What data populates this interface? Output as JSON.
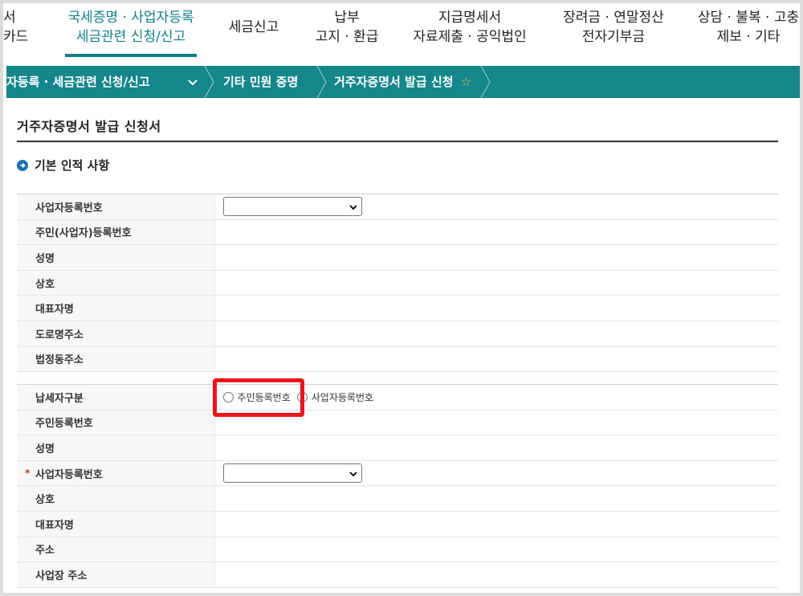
{
  "topnav": {
    "items": [
      {
        "line1": "서",
        "line2": "카드"
      },
      {
        "line1": "국세증명 · 사업자등록",
        "line2": "세금관련 신청/신고"
      },
      {
        "line1": "세금신고",
        "line2": ""
      },
      {
        "line1": "납부",
        "line2": "고지 · 환급"
      },
      {
        "line1": "지급명세서",
        "line2": "자료제출 · 공익법인"
      },
      {
        "line1": "장려금 · 연말정산",
        "line2": "전자기부금"
      },
      {
        "line1": "상담 · 불복 · 고충",
        "line2": "제보 · 기타"
      }
    ]
  },
  "breadcrumb": {
    "level1": "자등록 · 세금관련 신청/신고",
    "level2": "기타 민원 증명",
    "level3": "거주자증명서 발급 신청",
    "star_icon": "star-outline-icon"
  },
  "page": {
    "title": "거주자증명서 발급 신청서",
    "section_title": "기본 인적 사항"
  },
  "basic_info": {
    "rows": [
      "사업자등록번호",
      "주민(사업자)등록번호",
      "성명",
      "상호",
      "대표자명",
      "도로명주소",
      "법정동주소"
    ]
  },
  "taxpayer": {
    "type_label": "납세자구분",
    "option_resident": "주민등록번호",
    "option_business": "사업자등록번호",
    "resident_no_label": "주민등록번호",
    "name_label": "성명",
    "business_no_label": "사업자등록번호",
    "required_mark": "*",
    "company_label": "상호",
    "ceo_label": "대표자명",
    "address_label": "주소",
    "workplace_address_label": "사업장 주소"
  },
  "colors": {
    "teal": "#14868c",
    "highlight": "#e8151b",
    "section_dot": "#1f6fb3"
  }
}
